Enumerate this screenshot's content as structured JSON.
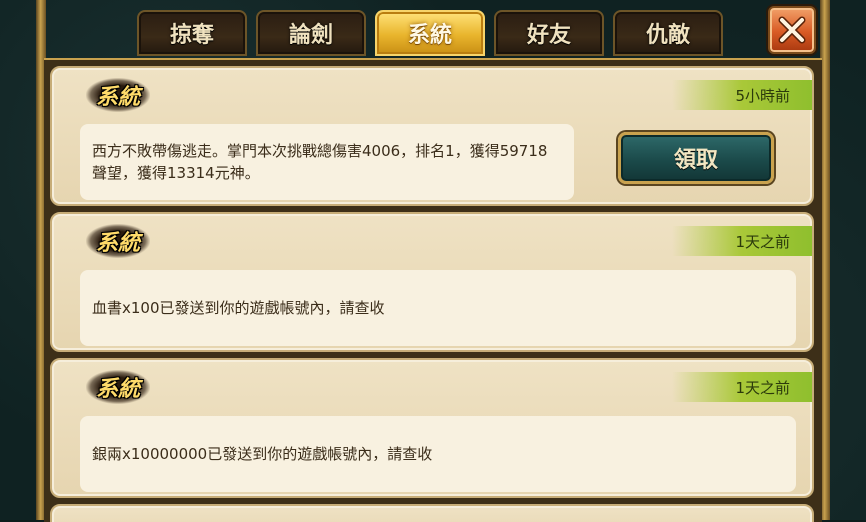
{
  "tabs": [
    {
      "label": "掠奪",
      "active": false
    },
    {
      "label": "論劍",
      "active": false
    },
    {
      "label": "系統",
      "active": true
    },
    {
      "label": "好友",
      "active": false
    },
    {
      "label": "仇敵",
      "active": false
    }
  ],
  "close_icon": "close-x-icon",
  "messages": [
    {
      "sender": "系統",
      "time": "5小時前",
      "text": "西方不敗帶傷逃走。掌門本次挑戰總傷害4006，排名1，獲得59718聲望，獲得13314元神。",
      "claim_label": "領取"
    },
    {
      "sender": "系統",
      "time": "1天之前",
      "text": "血書x100已發送到你的遊戲帳號內，請查收"
    },
    {
      "sender": "系統",
      "time": "1天之前",
      "text": "銀兩x10000000已發送到你的遊戲帳號內，請查收"
    }
  ],
  "colors": {
    "active_tab": "#e9b52d",
    "close_button": "#d85a24",
    "time_badge": "#a9c838",
    "claim_button": "#1b4a4a"
  }
}
